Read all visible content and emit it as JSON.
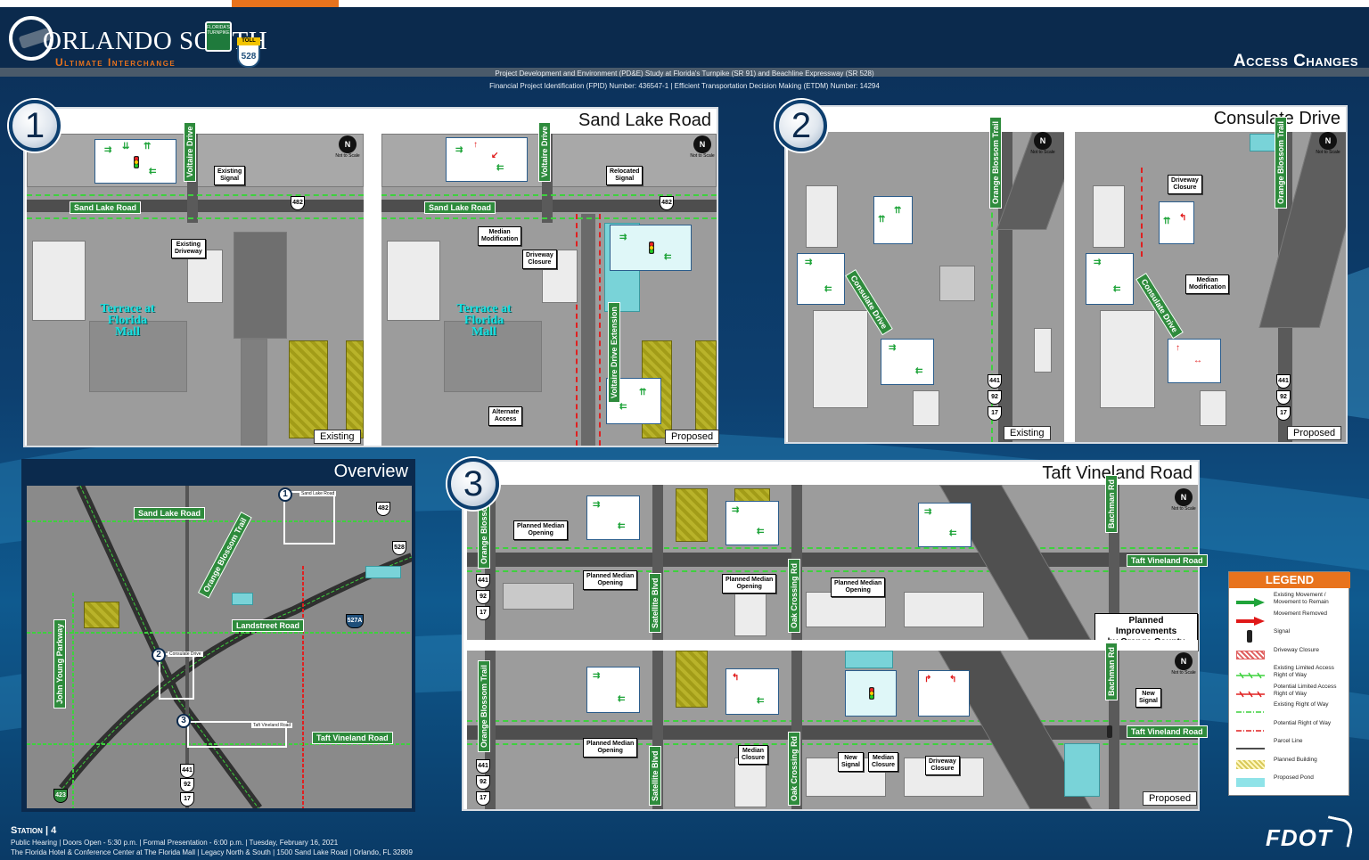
{
  "header": {
    "brand_title": "ORLANDO SOUTH",
    "brand_subtitle": "Ultimate Interchange",
    "turnpike_shield": "FLORIDA'S TURNPIKE",
    "toll_label": "TOLL",
    "route_528": "528",
    "page_heading": "Access Changes",
    "study_line1": "Project Development and Environment (PD&E) Study at Florida's Turnpike (SR 91) and Beachline Expressway (SR 528)",
    "study_line2": "Financial Project Identification (FPID) Number: 436547-1 |  Efficient Transportation Decision Making (ETDM) Number: 14294"
  },
  "panel1": {
    "number": "1",
    "title": "Sand Lake Road",
    "existing": {
      "street_main": "Sand Lake Road",
      "street_cross": "Voltaire Drive",
      "route": "482",
      "mall": "Terrace at\nFlorida\nMall",
      "callouts": [
        "Existing\nSignal",
        "Existing\nDriveway"
      ],
      "mode": "Existing"
    },
    "proposed": {
      "street_main": "Sand Lake Road",
      "street_cross": "Voltaire Drive",
      "street_ext": "Voltaire Drive Extension",
      "route": "482",
      "mall": "Terrace at\nFlorida\nMall",
      "callouts": [
        "Relocated\nSignal",
        "Median\nModification",
        "Driveway\nClosure",
        "Alternate\nAccess"
      ],
      "mode": "Proposed"
    },
    "north_label": "Not to Scale"
  },
  "panel2": {
    "number": "2",
    "title": "Consulate Drive",
    "existing": {
      "street_curve": "Consulate Drive",
      "street_cross": "Orange Blossom Trail",
      "routes": [
        "441",
        "92",
        "17"
      ],
      "mode": "Existing"
    },
    "proposed": {
      "street_curve": "Consulate Drive",
      "street_cross": "Orange Blossom Trail",
      "routes": [
        "441",
        "92",
        "17"
      ],
      "callouts": [
        "Driveway\nClosure",
        "Median\nModification"
      ],
      "mode": "Proposed"
    },
    "north_label": "Not to Scale"
  },
  "overview": {
    "title": "Overview",
    "roads": [
      "Sand Lake Road",
      "Orange Blossom Trail",
      "Landstreet Road",
      "John Young Parkway",
      "Taft Vineland Road"
    ],
    "routes": [
      "482",
      "528",
      "527A",
      "441",
      "92",
      "17",
      "423"
    ],
    "areas": [
      {
        "num": "1",
        "label": "Sand Lake Road"
      },
      {
        "num": "2",
        "label": "Consulate Drive"
      },
      {
        "num": "3",
        "label": "Taft Vineland Road"
      }
    ]
  },
  "panel3": {
    "number": "3",
    "title": "Taft Vineland Road",
    "top": {
      "street_main": "Taft Vineland Road",
      "cross_streets": [
        "Orange Blossom Trail",
        "Satellite Blvd",
        "Oak Crossing Rd",
        "Bachman Rd"
      ],
      "routes": [
        "441",
        "92",
        "17"
      ],
      "callouts": [
        "Planned Median\nOpening",
        "Planned Median\nOpening",
        "Planned Median\nOpening",
        "Planned Median\nOpening"
      ],
      "note": "Planned Improvements\nby Orange County"
    },
    "bottom": {
      "street_main": "Taft Vineland Road",
      "cross_streets": [
        "Orange Blossom Trail",
        "Satellite Blvd",
        "Oak Crossing Rd",
        "Bachman Rd"
      ],
      "routes": [
        "441",
        "92",
        "17"
      ],
      "callouts": [
        "Planned Median\nOpening",
        "Median\nClosure",
        "New\nSignal",
        "Median\nClosure",
        "Driveway\nClosure",
        "New\nSignal"
      ],
      "mode": "Proposed"
    },
    "north_label": "Not to Scale"
  },
  "legend": {
    "title": "LEGEND",
    "items": [
      {
        "label": "Existing Movement / Movement to Remain",
        "color": "#1fa43a"
      },
      {
        "label": "Movement Removed",
        "color": "#e01818"
      },
      {
        "label": "Signal",
        "color": "#222222"
      },
      {
        "label": "Driveway Closure",
        "color": "#e06060"
      },
      {
        "label": "Existing Limited Access Right of Way",
        "color": "#3dd13d"
      },
      {
        "label": "Potential Limited Access Right of Way",
        "color": "#e02020"
      },
      {
        "label": "Existing Right of Way",
        "color": "#3dd13d"
      },
      {
        "label": "Potential Right of Way",
        "color": "#e02020"
      },
      {
        "label": "Parcel Line",
        "color": "#111111"
      },
      {
        "label": "Planned Building",
        "color": "#d9c95a"
      },
      {
        "label": "Proposed Pond",
        "color": "#8fe3e8"
      }
    ]
  },
  "footer": {
    "station": "Station | 4",
    "line1": "Public Hearing | Doors Open - 5:30 p.m. | Formal Presentation - 6:00 p.m. | Tuesday, February 16, 2021",
    "line2": "The Florida Hotel & Conference Center at The Florida Mall | Legacy North & South | 1500 Sand Lake Road | Orlando, FL 32809",
    "agency": "FDOT"
  }
}
